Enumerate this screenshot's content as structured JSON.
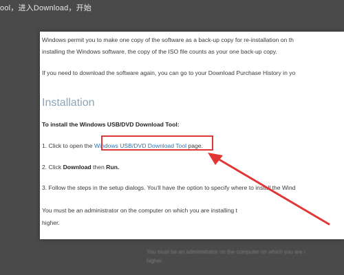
{
  "caption": "ool，进入Download，开始",
  "doc": {
    "line1": "Windows permit you to make one copy of the software as a back-up copy for re-installation on th",
    "line2": "installing the Windows software, the copy of the ISO file counts as your one back-up copy.",
    "line3": "If you need to download the software again, you can go to your Download Purchase History in yo",
    "heading": "Installation",
    "subheading": "To install the Windows USB/DVD Download Tool:",
    "step1_prefix": "1. Click to open the ",
    "step1_link": "Windows USB/DVD Download Tool",
    "step1_suffix": " page.",
    "step2_prefix": "2. Click ",
    "step2_bold1": "Download",
    "step2_mid": " then ",
    "step2_bold2": "Run.",
    "step3": "3. Follow the steps in the setup dialogs. You'll have the option to specify where to install the Wind",
    "admin_line1": "You must be an administrator on the computer on which you are installing t",
    "admin_line2": "higher."
  },
  "background_text": {
    "line1": "You must be an administrator on the computer on which you are i",
    "line2": "higher."
  },
  "colors": {
    "highlight": "#e23636",
    "link": "#2f74b5",
    "heading": "#8aa4b8"
  }
}
